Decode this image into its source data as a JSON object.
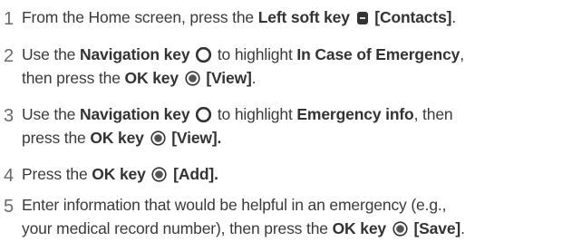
{
  "steps": [
    {
      "number": "1",
      "parts": {
        "a": "From the Home screen, press the ",
        "b": "Left soft key",
        "c": " ",
        "d": "[Contacts]",
        "e": "."
      },
      "icon": "soft-key-icon"
    },
    {
      "number": "2",
      "parts": {
        "a": "Use the ",
        "b": "Navigation key",
        "c": " to highlight ",
        "d": "In Case of Emergency",
        "e": ",",
        "f": "then press the ",
        "g": "OK key",
        "h": " ",
        "i": "[View]",
        "j": "."
      },
      "icons": [
        "navigation-key-icon",
        "ok-key-icon"
      ]
    },
    {
      "number": "3",
      "parts": {
        "a": "Use the ",
        "b": "Navigation key",
        "c": " to highlight ",
        "d": "Emergency info",
        "e": ", then",
        "f": "press the ",
        "g": "OK key",
        "h": " ",
        "i": "[View]."
      },
      "icons": [
        "navigation-key-icon",
        "ok-key-icon"
      ]
    },
    {
      "number": "4",
      "parts": {
        "a": "Press the ",
        "b": "OK key",
        "c": " ",
        "d": "[Add]."
      },
      "icon": "ok-key-icon"
    },
    {
      "number": "5",
      "parts": {
        "a": "Enter information that would be helpful in an emergency (e.g.,",
        "b": "your medical record number), then press the ",
        "c": "OK key",
        "d": " ",
        "e": "[Save]",
        "f": "."
      },
      "icon": "ok-key-icon"
    }
  ],
  "colors": {
    "text": "#3a3a3a",
    "number": "#6a6a6a",
    "icon": "#333333"
  }
}
